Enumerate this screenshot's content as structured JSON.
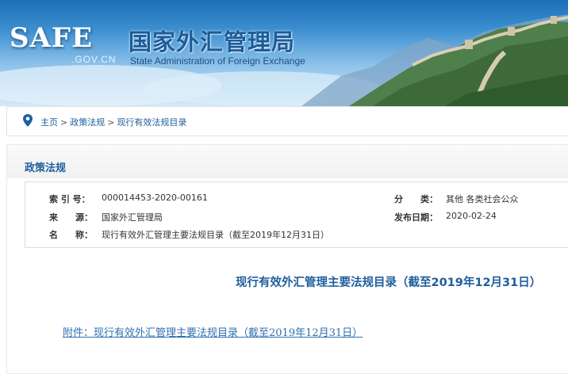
{
  "header": {
    "logo_text": "SAFE",
    "logo_domain": ".GOV.CN",
    "title_cn": "国家外汇管理局",
    "title_en": "State Administration of Foreign Exchange"
  },
  "breadcrumb": {
    "items": [
      "主页",
      "政策法规",
      "现行有效法规目录"
    ],
    "separator": ">"
  },
  "panel": {
    "title": "政策法规"
  },
  "metadata": {
    "index_label": "索 引 号：",
    "index_value": "000014453-2020-00161",
    "category_label": "分　　类：",
    "category_value": "其他  各类社会公众",
    "source_label": "来　　源：",
    "source_value": "国家外汇管理局",
    "date_label": "发布日期：",
    "date_value": "2020-02-24",
    "name_label": "名　　称：",
    "name_value": "现行有效外汇管理主要法规目录（截至2019年12月31日）"
  },
  "document": {
    "heading": "现行有效外汇管理主要法规目录（截至2019年12月31日）",
    "attachment_link": "附件：现行有效外汇管理主要法规目录（截至2019年12月31日）"
  },
  "colors": {
    "brand_blue": "#1e5e9c",
    "link_blue": "#2e6fb0"
  }
}
